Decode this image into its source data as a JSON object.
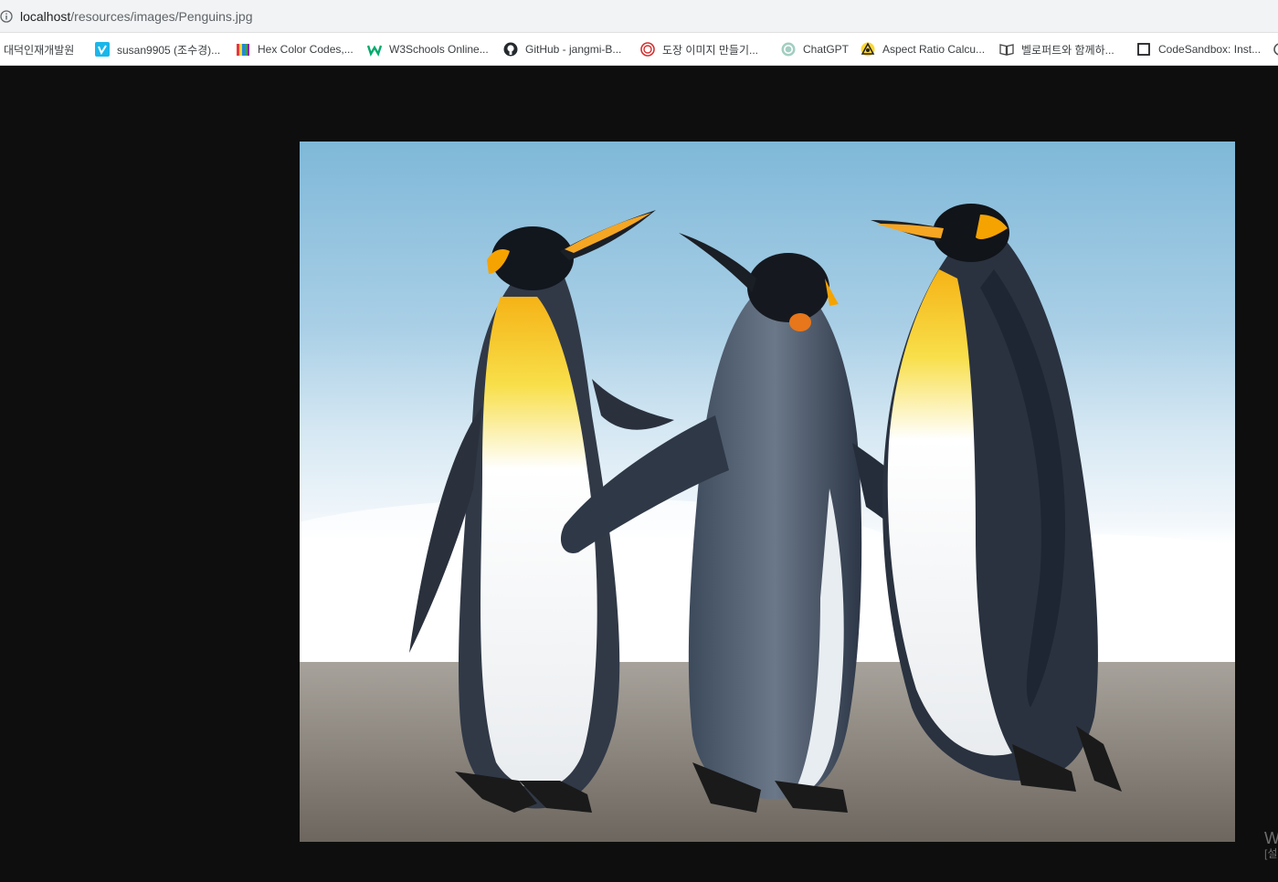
{
  "browser": {
    "url_host": "localhost",
    "url_path": "/resources/images/Penguins.jpg"
  },
  "bookmarks": [
    {
      "label": "대덕인재개발원",
      "icon": "none"
    },
    {
      "label": "susan9905 (조수경)...",
      "icon": "vimeo-v-icon"
    },
    {
      "label": "Hex Color Codes,...",
      "icon": "color-book-icon"
    },
    {
      "label": "W3Schools Online...",
      "icon": "w3schools-icon"
    },
    {
      "label": "GitHub - jangmi-B...",
      "icon": "github-icon"
    },
    {
      "label": "도장 이미지 만들기...",
      "icon": "stamp-icon"
    },
    {
      "label": "ChatGPT",
      "icon": "chatgpt-icon"
    },
    {
      "label": "Aspect Ratio Calcu...",
      "icon": "aspect-ratio-icon"
    },
    {
      "label": "벨로퍼트와 함께하...",
      "icon": "book-icon"
    },
    {
      "label": "CodeSandbox: Inst...",
      "icon": "codesandbox-icon"
    }
  ],
  "viewer": {
    "background": "#0e0e0e",
    "image_subject": "three king penguins on a beach",
    "watermark_line1": "W",
    "watermark_line2": "[설"
  }
}
